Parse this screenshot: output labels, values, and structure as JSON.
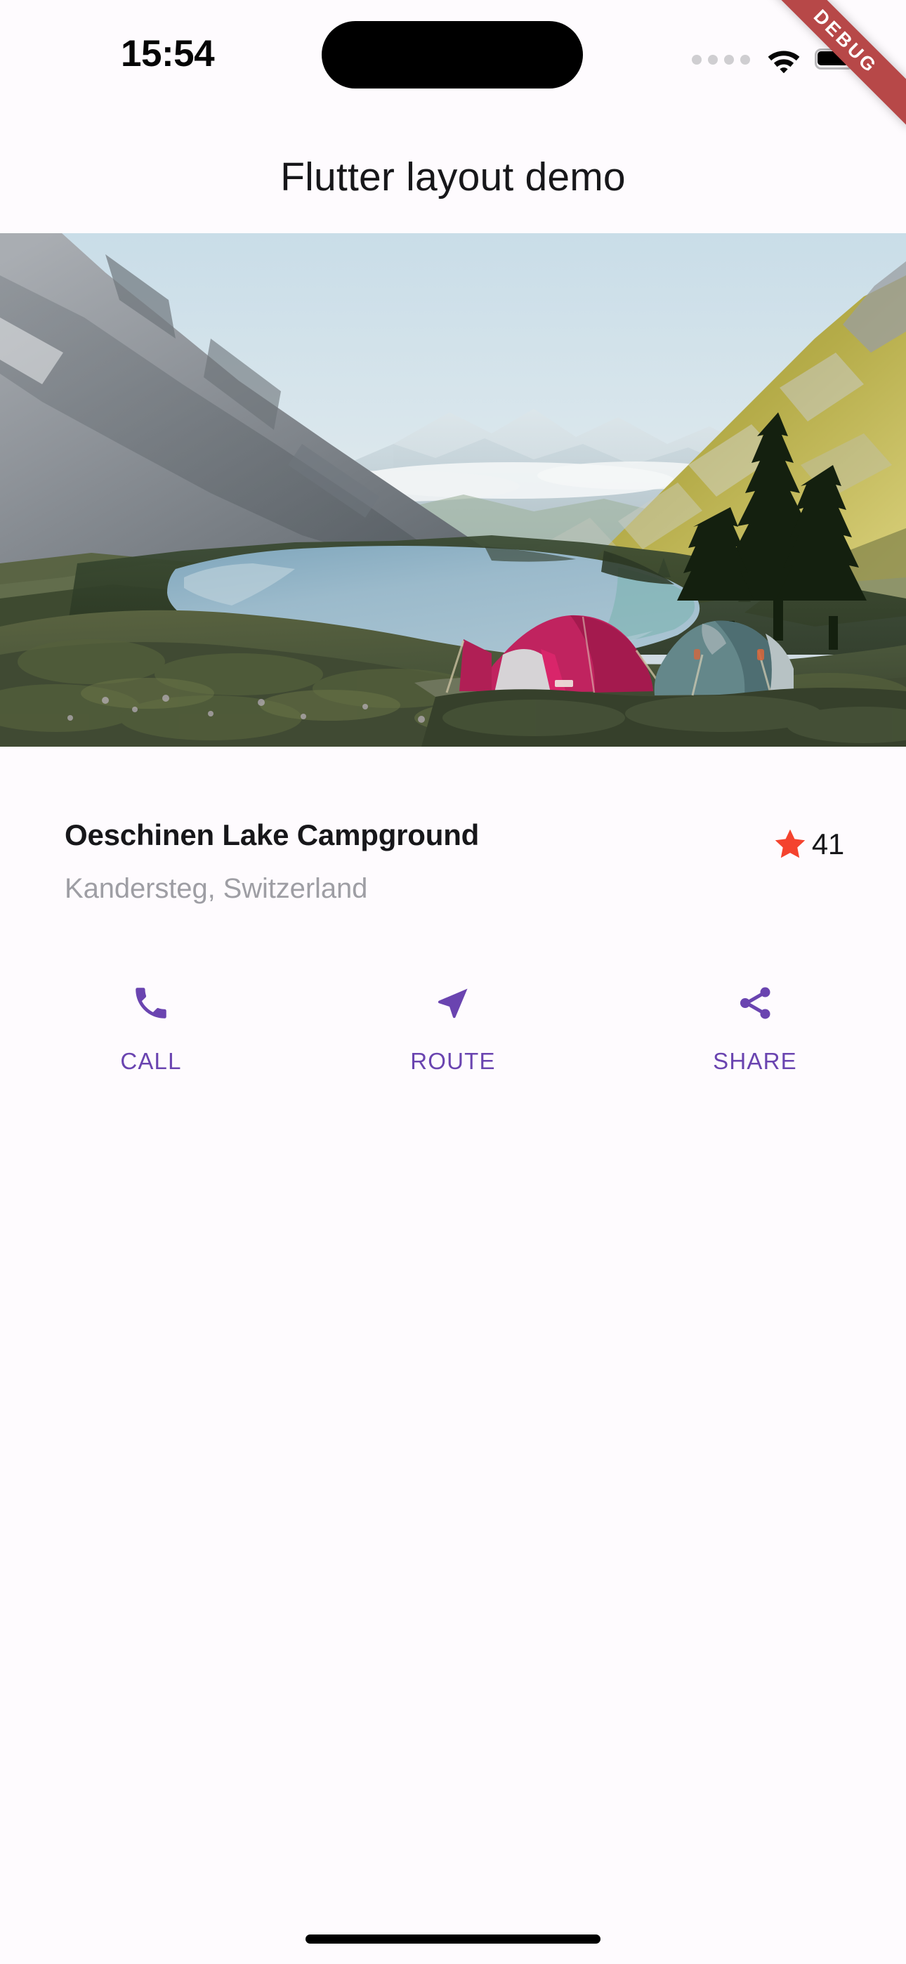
{
  "status_bar": {
    "time": "15:54",
    "icons": [
      "cellular-dots",
      "wifi-icon",
      "battery-icon"
    ],
    "battery_level_percent": 100
  },
  "debug_banner": {
    "label": "DEBUG",
    "color": "#B74848",
    "text_color": "#FFFFFF"
  },
  "app_bar": {
    "title": "Flutter layout demo",
    "background": "#FEFBFE",
    "title_color": "#17171A"
  },
  "hero_image": {
    "alt": "Oeschinen Lake mountain panorama with two tents in an alpine meadow",
    "sky_color": "#D3E2EA",
    "lake_color": "#93B3C6",
    "rock_color": "#8C8F93",
    "grass_color": "#A89A3E",
    "tent_colors": [
      "#C8256B",
      "#6E8E90"
    ]
  },
  "place": {
    "title": "Oeschinen Lake Campground",
    "subtitle": "Kandersteg, Switzerland",
    "rating_count": "41",
    "star_color": "#F4432E",
    "title_color": "#17171A",
    "subtitle_color": "#9E9EA4"
  },
  "actions": {
    "accent_color": "#6A44B0",
    "items": [
      {
        "id": "call",
        "label": "CALL",
        "icon": "phone-icon"
      },
      {
        "id": "route",
        "label": "ROUTE",
        "icon": "navigation-arrow-icon"
      },
      {
        "id": "share",
        "label": "SHARE",
        "icon": "share-icon"
      }
    ]
  },
  "home_indicator": {
    "color": "#000000"
  }
}
